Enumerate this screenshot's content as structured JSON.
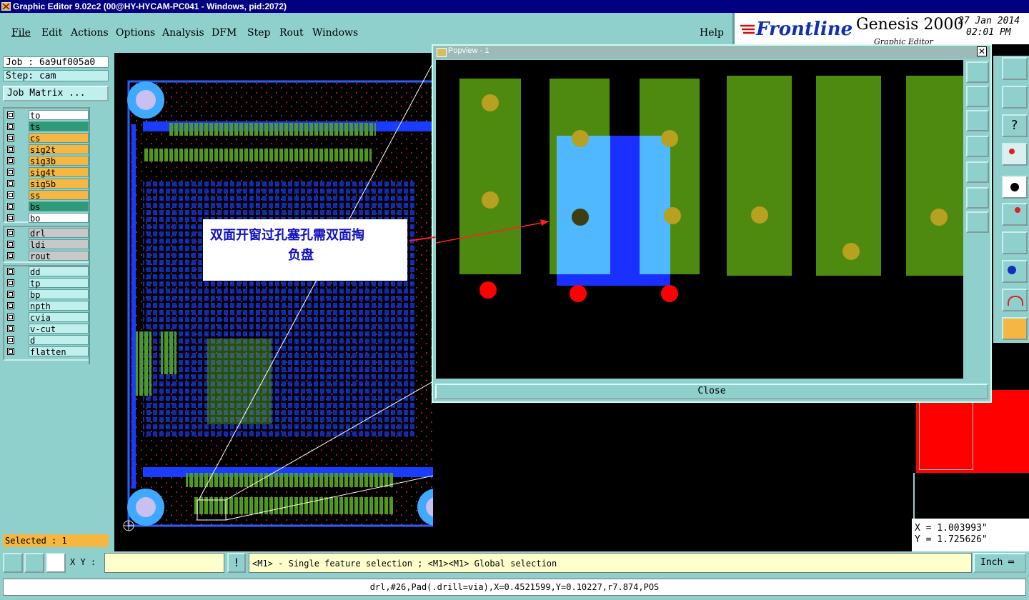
{
  "window": {
    "title": "Graphic Editor 9.02c2 (00@HY-HYCAM-PC041 - Windows, pid:2072)"
  },
  "menu": [
    "File",
    "Edit",
    "Actions",
    "Options",
    "Analysis",
    "DFM",
    "Step",
    "Rout",
    "Windows"
  ],
  "help_label": "Help",
  "brand": {
    "logo": "Frontline",
    "product": "Genesis 2000",
    "date": "27 Jan 2014",
    "time": "02:01 PM",
    "subtitle": "Graphic Editor"
  },
  "job": {
    "job_label": "Job : 6a9uf005a0",
    "step_label": "Step: cam",
    "matrix_button": "Job Matrix ..."
  },
  "layers_group1": [
    {
      "name": "to",
      "color": "#ffffff"
    },
    {
      "name": "ts",
      "color": "#2e9a7a"
    },
    {
      "name": "cs",
      "color": "#f5b642"
    },
    {
      "name": "sig2t",
      "color": "#f5b642"
    },
    {
      "name": "sig3b",
      "color": "#f5b642"
    },
    {
      "name": "sig4t",
      "color": "#f5b642"
    },
    {
      "name": "sig5b",
      "color": "#f5b642"
    },
    {
      "name": "ss",
      "color": "#f5b642"
    },
    {
      "name": "bs",
      "color": "#2e9a7a"
    },
    {
      "name": "bo",
      "color": "#ffffff"
    }
  ],
  "layers_group2": [
    {
      "name": "drl",
      "color": "#c8c8c8"
    },
    {
      "name": "ldi",
      "color": "#c8c8c8"
    },
    {
      "name": "rout",
      "color": "#c8c8c8"
    }
  ],
  "layers_group3": [
    {
      "name": "dd",
      "color": "#bff0ee"
    },
    {
      "name": "tp",
      "color": "#bff0ee"
    },
    {
      "name": "bp",
      "color": "#bff0ee"
    },
    {
      "name": "npth",
      "color": "#bff0ee"
    },
    {
      "name": "cvia",
      "color": "#bff0ee"
    },
    {
      "name": "v-cut",
      "color": "#bff0ee"
    },
    {
      "name": "d",
      "color": "#bff0ee"
    },
    {
      "name": "flatten",
      "color": "#bff0ee"
    }
  ],
  "selected_label": "Selected : 1",
  "annotation": {
    "line1": "双面开窗过孔塞孔需双面掏",
    "line2": "负盘"
  },
  "popview": {
    "title": "Popview - 1",
    "close_label": "Close"
  },
  "coords": {
    "x": "X = 1.003993\"",
    "y": "Y = 1.725626\""
  },
  "xy_label": "X Y :",
  "hint": "<M1> - Single feature selection ; <M1><M1> Global selection",
  "units": "Inch",
  "feature_info": "drl,#26,Pad(.drill=via),X=0.4521599,Y=0.10227,r7.874,POS"
}
